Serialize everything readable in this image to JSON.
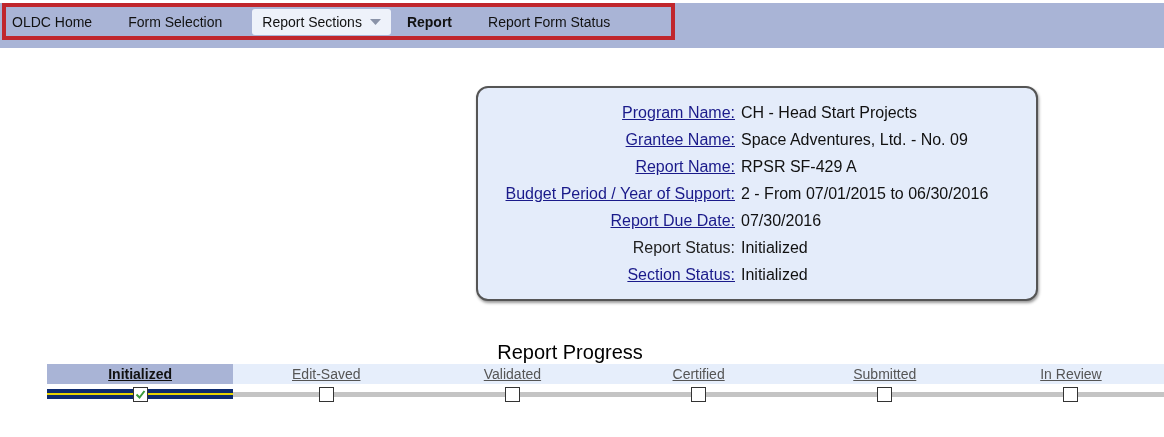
{
  "nav": [
    {
      "label": "OLDC Home",
      "kind": "link",
      "selected": false
    },
    {
      "label": "Form Selection",
      "kind": "link",
      "selected": false
    },
    {
      "label": "Report Sections",
      "kind": "dropdown",
      "selected": false
    },
    {
      "label": "Report",
      "kind": "link",
      "selected": true
    },
    {
      "label": "Report Form Status",
      "kind": "link",
      "selected": false
    }
  ],
  "info": [
    {
      "label": "Program Name:",
      "value": "CH - Head Start Projects",
      "link": true
    },
    {
      "label": "Grantee Name:",
      "value": "Space Adventures, Ltd. - No. 09",
      "link": true
    },
    {
      "label": "Report Name:",
      "value": "RPSR SF-429 A",
      "link": true
    },
    {
      "label": "Budget Period / Year of Support:",
      "value": "2 - From 07/01/2015 to 06/30/2016",
      "link": true
    },
    {
      "label": "Report Due Date:",
      "value": "07/30/2016",
      "link": true
    },
    {
      "label": "Report Status:",
      "value": "Initialized",
      "link": false
    },
    {
      "label": "Section Status:",
      "value": "Initialized",
      "link": true
    }
  ],
  "progress": {
    "title": "Report Progress",
    "steps": [
      {
        "label": "Initialized",
        "selected": true,
        "checked": true
      },
      {
        "label": "Edit-Saved",
        "selected": false,
        "checked": false
      },
      {
        "label": "Validated",
        "selected": false,
        "checked": false
      },
      {
        "label": "Certified",
        "selected": false,
        "checked": false
      },
      {
        "label": "Submitted",
        "selected": false,
        "checked": false
      },
      {
        "label": "In Review",
        "selected": false,
        "checked": false
      }
    ]
  }
}
